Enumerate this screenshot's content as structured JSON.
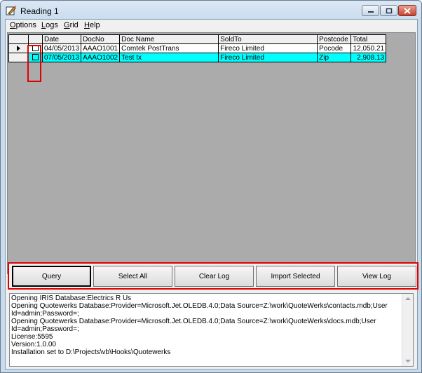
{
  "window": {
    "title": "Reading 1"
  },
  "menu": [
    {
      "accel": "O",
      "rest": "ptions"
    },
    {
      "accel": "L",
      "rest": "ogs"
    },
    {
      "accel": "G",
      "rest": "rid"
    },
    {
      "accel": "H",
      "rest": "elp"
    }
  ],
  "grid": {
    "columns": [
      "",
      "Date",
      "DocNo",
      "Doc Name",
      "SoldTo",
      "Postcode",
      "Total"
    ],
    "rows": [
      {
        "checked": false,
        "current": true,
        "date": "04/05/2013",
        "docno": "AAAO1001",
        "docname": "Comtek PostTrans",
        "soldto": "Fireco Limited",
        "postcode": "Pocode",
        "total": "12,050.21"
      },
      {
        "checked": false,
        "current": false,
        "date": "07/05/2013",
        "docno": "AAAO1002",
        "docname": "Test tx",
        "soldto": "Fireco Limited",
        "postcode": "Zip",
        "total": "2,908.13"
      }
    ]
  },
  "buttons": {
    "query": "Query",
    "select_all": "Select All",
    "clear_log": "Clear Log",
    "import_selected": "Import Selected",
    "view_log": "View Log"
  },
  "log": [
    "Opening IRIS Database:Electrics R Us",
    "Opening Quotewerks Database:Provider=Microsoft.Jet.OLEDB.4.0;Data Source=Z:\\work\\QuoteWerks\\contacts.mdb;User",
    "Id=admin;Password=;",
    "Opening Quotewerks Database:Provider=Microsoft.Jet.OLEDB.4.0;Data Source=Z:\\work\\QuoteWerks\\docs.mdb;User Id=admin;Password=;",
    "License:5595",
    "Version:1.0.00",
    "Installation set to D:\\Projects\\vb\\Hooks\\Quotewerks"
  ],
  "colors": {
    "selected_row": "#00ffff",
    "highlight_border": "#e00000",
    "grid_background": "#ababab"
  }
}
